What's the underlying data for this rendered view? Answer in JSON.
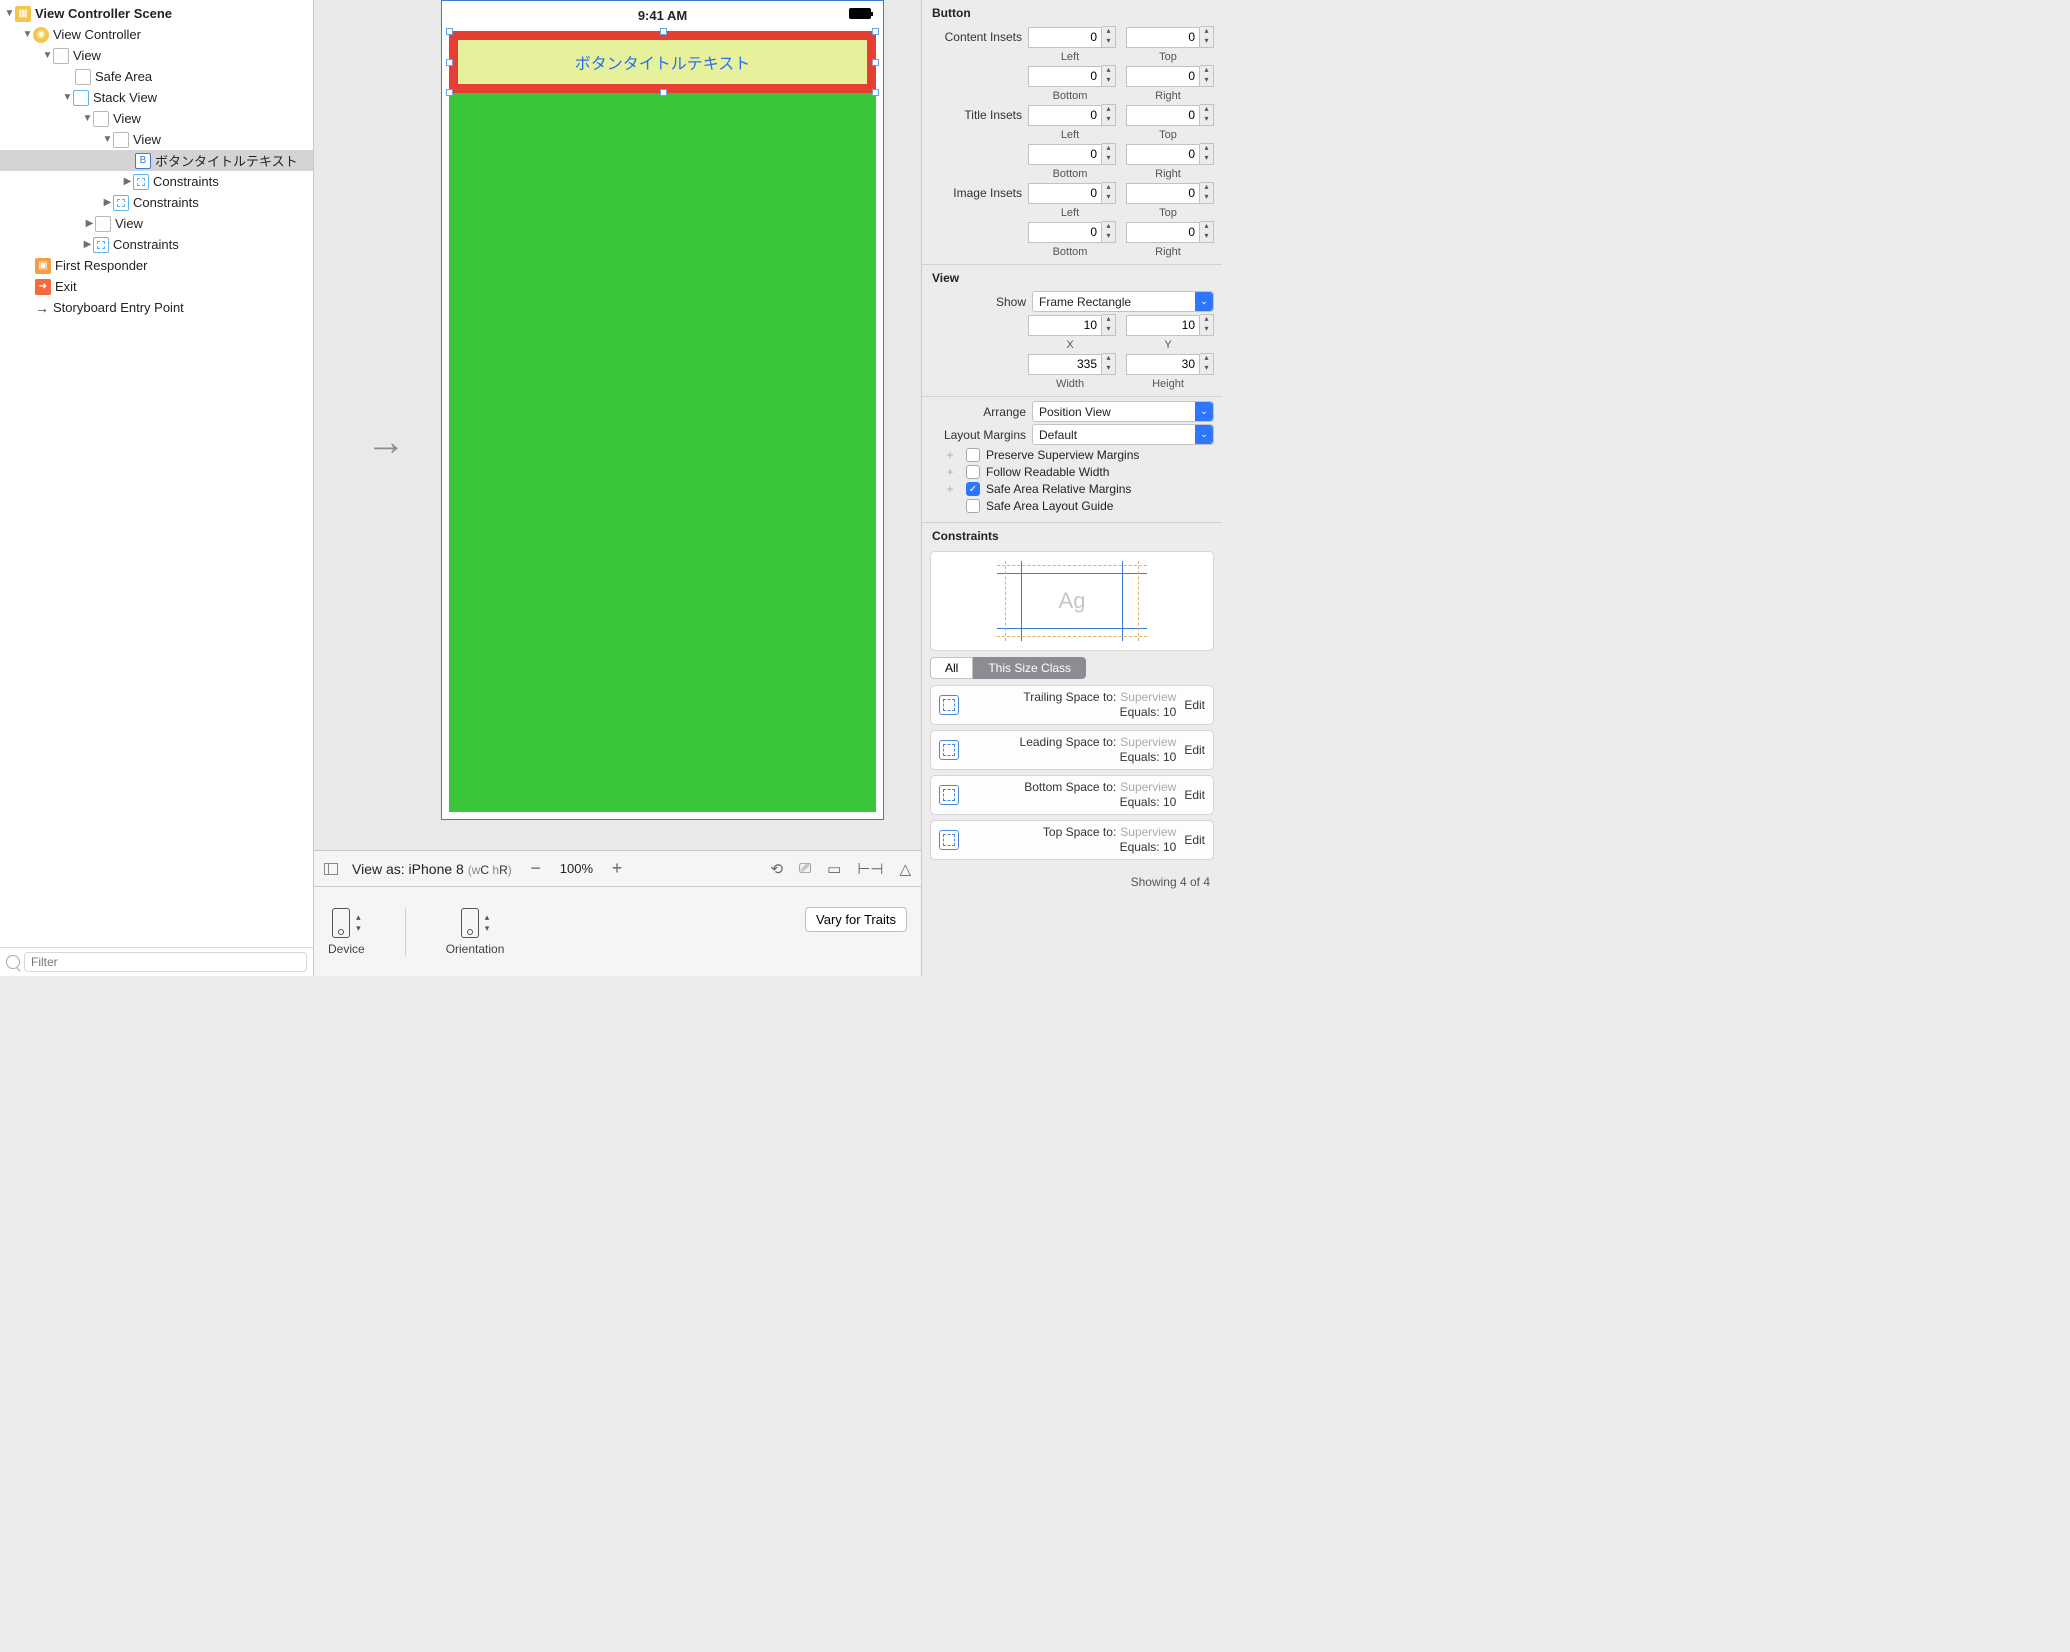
{
  "tree": {
    "scene": "View Controller Scene",
    "vc": "View Controller",
    "view": "View",
    "safe_area": "Safe Area",
    "stack": "Stack View",
    "inner_view1": "View",
    "inner_view2": "View",
    "button_item": "ボタンタイトルテキスト",
    "constraints": "Constraints",
    "first_responder": "First Responder",
    "exit": "Exit",
    "entry": "Storyboard Entry Point"
  },
  "filter_placeholder": "Filter",
  "canvas": {
    "time": "9:41 AM",
    "button_text": "ボタンタイトルテキスト"
  },
  "canvas_bar": {
    "view_as": "View as: iPhone 8 ",
    "wc_pre": "(",
    "wc_w": "w",
    "wc_c": "C ",
    "wc_h": "h",
    "wc_r": "R",
    "wc_post": ")",
    "zoom": "100%",
    "device": "Device",
    "orientation": "Orientation",
    "vary": "Vary for Traits"
  },
  "inspector": {
    "button_title": "Button",
    "content_insets": "Content Insets",
    "title_insets": "Title Insets",
    "image_insets": "Image Insets",
    "left": "Left",
    "top": "Top",
    "bottom": "Bottom",
    "right": "Right",
    "insets": {
      "content": {
        "left": "0",
        "top": "0",
        "bottom": "0",
        "right": "0"
      },
      "title": {
        "left": "0",
        "top": "0",
        "bottom": "0",
        "right": "0"
      },
      "image": {
        "left": "0",
        "top": "0",
        "bottom": "0",
        "right": "0"
      }
    },
    "view_title": "View",
    "show_label": "Show",
    "show_value": "Frame Rectangle",
    "x": "10",
    "y": "10",
    "width": "335",
    "height": "30",
    "x_l": "X",
    "y_l": "Y",
    "w_l": "Width",
    "h_l": "Height",
    "arrange_label": "Arrange",
    "arrange_value": "Position View",
    "layout_margins_label": "Layout Margins",
    "layout_margins_value": "Default",
    "chk_preserve": "Preserve Superview Margins",
    "chk_readable": "Follow Readable Width",
    "chk_safe_rel": "Safe Area Relative Margins",
    "chk_safe_guide": "Safe Area Layout Guide",
    "constraints_title": "Constraints",
    "ag": "Ag",
    "seg_all": "All",
    "seg_this": "This Size Class",
    "constraints": [
      {
        "label": "Trailing Space to:",
        "to": "Superview",
        "eq": "Equals:",
        "val": "10"
      },
      {
        "label": "Leading Space to:",
        "to": "Superview",
        "eq": "Equals:",
        "val": "10"
      },
      {
        "label": "Bottom Space to:",
        "to": "Superview",
        "eq": "Equals:",
        "val": "10"
      },
      {
        "label": "Top Space to:",
        "to": "Superview",
        "eq": "Equals:",
        "val": "10"
      }
    ],
    "edit": "Edit",
    "showing": "Showing 4 of 4"
  }
}
